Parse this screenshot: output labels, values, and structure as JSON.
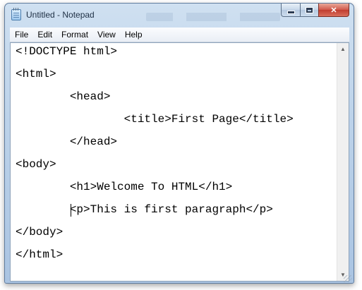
{
  "window": {
    "title": "Untitled - Notepad",
    "icon": "notepad-icon",
    "controls": {
      "minimize_icon": "minimize-icon",
      "maximize_icon": "maximize-icon",
      "close_glyph": "✕"
    }
  },
  "menu": {
    "items": [
      "File",
      "Edit",
      "Format",
      "View",
      "Help"
    ]
  },
  "editor": {
    "lines": [
      "<!DOCTYPE html>",
      "<html>",
      "        <head>",
      "                <title>First Page</title>",
      "        </head>",
      "<body>",
      "        <h1>Welcome To HTML</h1>",
      "        <p>This is first paragraph</p>",
      "</body>",
      "</html>"
    ]
  },
  "scrollbar": {
    "up_arrow": "▲",
    "down_arrow": "▼"
  }
}
